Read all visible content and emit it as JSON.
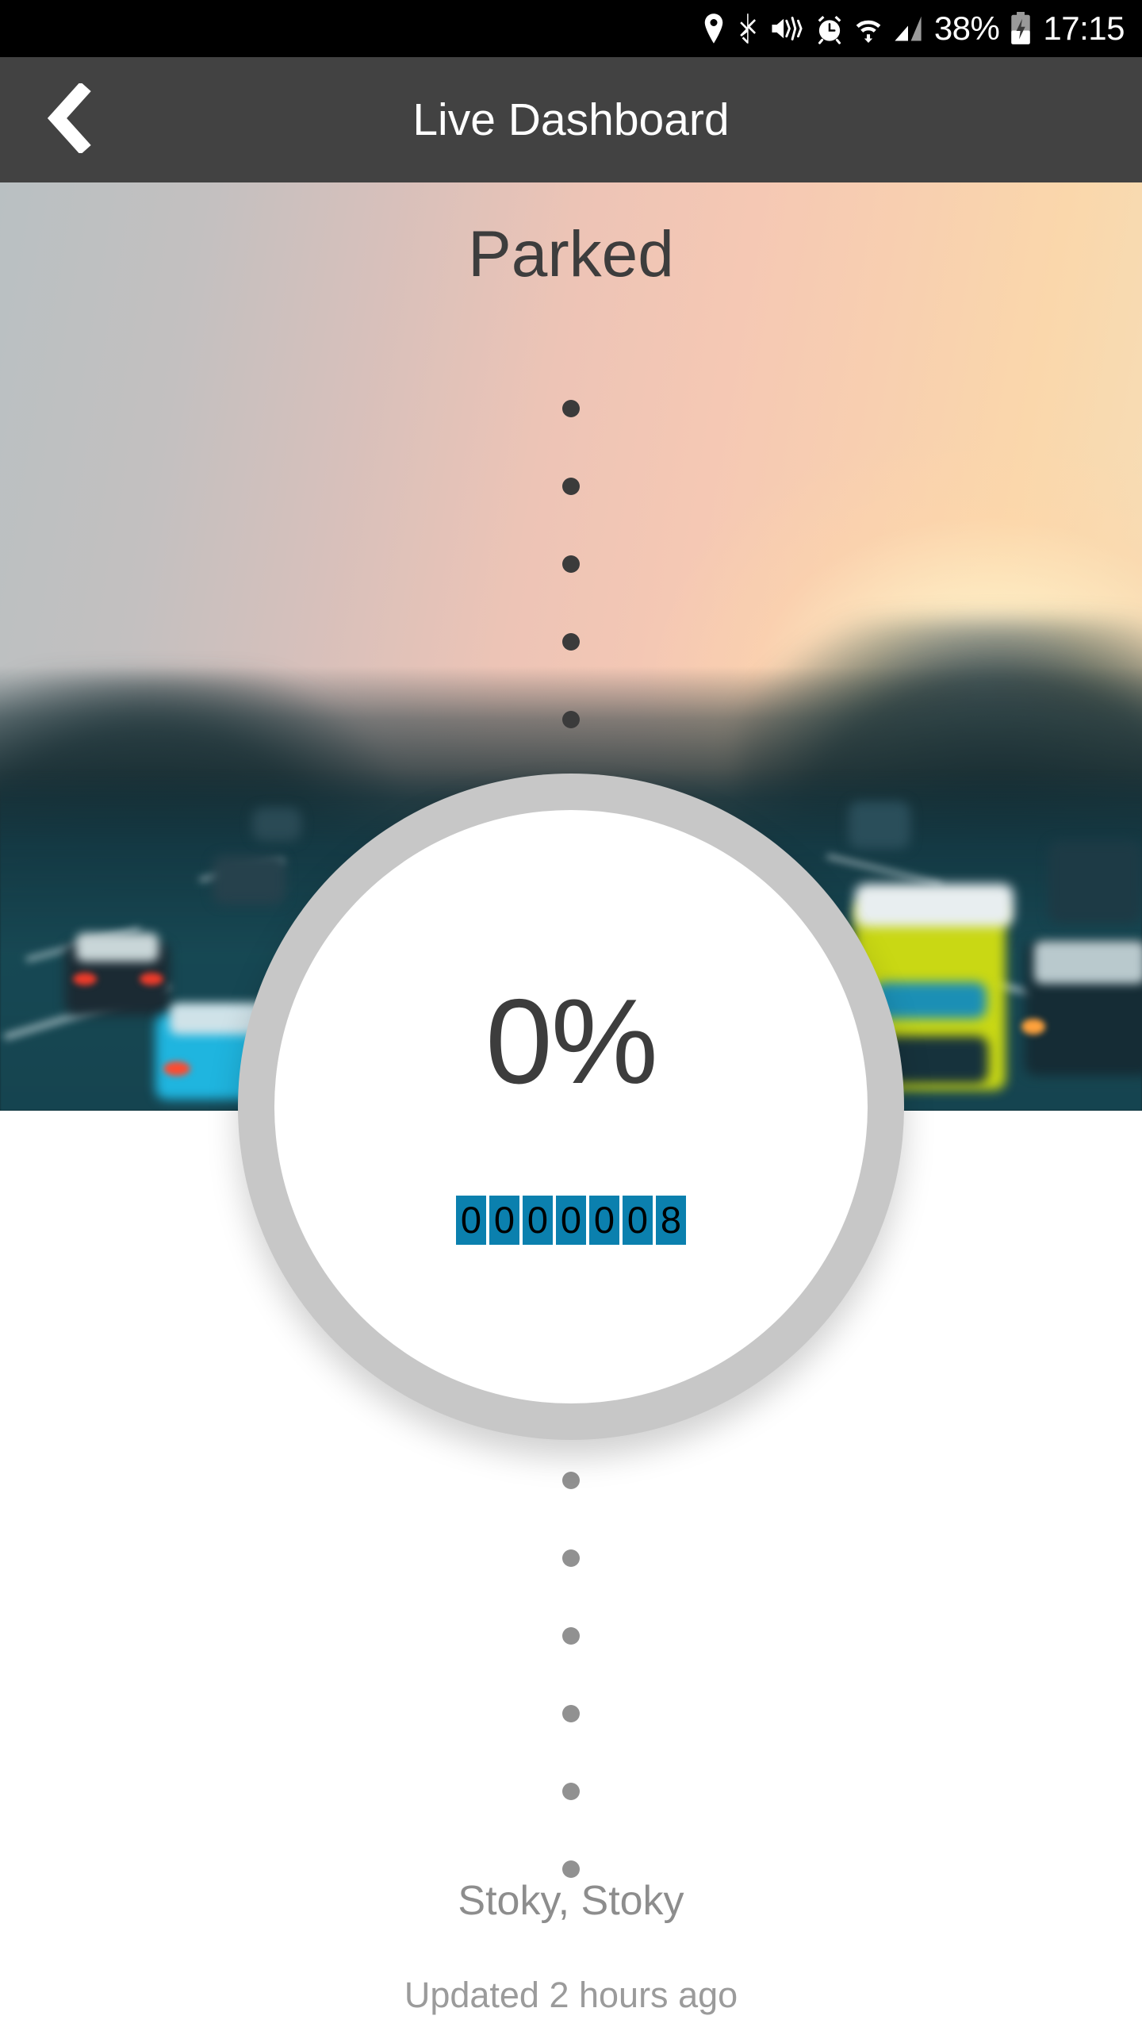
{
  "status_bar": {
    "battery_percent": "38%",
    "clock": "17:15",
    "icons": [
      "location-icon",
      "bluetooth-icon",
      "volume-mute-vibrate-icon",
      "alarm-clock-icon",
      "wifi-icon",
      "cellular-signal-icon"
    ]
  },
  "app_bar": {
    "title": "Live Dashboard",
    "back_icon": "chevron-left-icon"
  },
  "hero": {
    "status_label": "Parked"
  },
  "gauge": {
    "percent_label": "0%",
    "percent_value": 0,
    "odometer_digits": [
      "0",
      "0",
      "0",
      "0",
      "0",
      "0",
      "8"
    ],
    "odometer_value": "0000008"
  },
  "footer": {
    "location": "Stoky, Stoky",
    "updated": "Updated 2 hours ago"
  },
  "colors": {
    "status_bar_bg": "#000000",
    "app_bar_bg": "#424242",
    "app_bar_text": "#ffffff",
    "hero_status_text": "#3d3d3d",
    "gauge_ring": "#c7c7c7",
    "gauge_face": "#ffffff",
    "gauge_text": "#3d3d3d",
    "odometer_tile": "#0b80ae",
    "odometer_text": "#000000",
    "dot_top": "#3b3b3b",
    "dot_bottom": "#919191",
    "footer_text": "#8d8d8d",
    "page_bg": "#ffffff"
  }
}
